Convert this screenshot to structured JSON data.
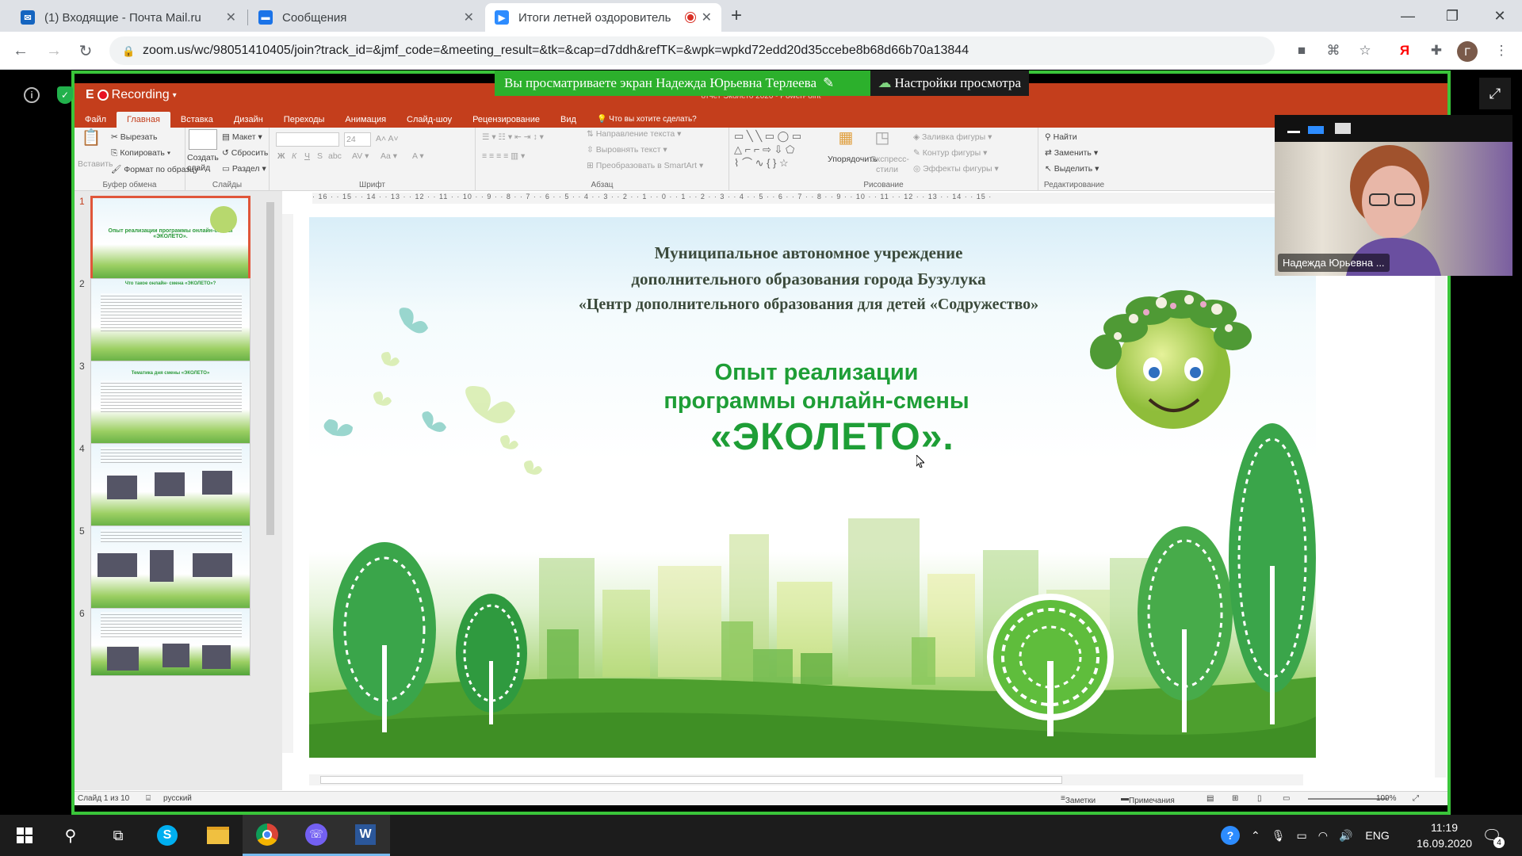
{
  "browser": {
    "tabs": [
      {
        "title": "(1) Входящие - Почта Mail.ru",
        "icon": "mail-icon",
        "color": "#1565c0"
      },
      {
        "title": "Сообщения",
        "icon": "chat-icon",
        "color": "#1a73e8"
      },
      {
        "title": "Итоги летней оздоровитель",
        "icon": "zoom-icon",
        "color": "#2d8cff"
      }
    ],
    "url": "zoom.us/wc/98051410405/join?track_id=&jmf_code=&meeting_result=&tk=&cap=d7ddh&refTK=&wpk=wpkd72edd20d35ccebe8b68d66b70a13844",
    "profile_letter": "Г"
  },
  "zoom": {
    "share_banner": "Вы просматриваете экран Надежда Юрьевна Терлеева",
    "view_options": "Настройки просмотра",
    "participant_name": "Надежда Юрьевна ...",
    "accent": "#2cb02c"
  },
  "ppt": {
    "recording_label": "Recording",
    "app_letter": "E",
    "window_title": "отчет Эколето 2020 - PowerPoint",
    "menu": [
      "Файл",
      "Главная",
      "Вставка",
      "Дизайн",
      "Переходы",
      "Анимация",
      "Слайд-шоу",
      "Рецензирование",
      "Вид"
    ],
    "tell_me": "Что вы хотите сделать?",
    "ribbon": {
      "paste": "Вставить",
      "cut": "Вырезать",
      "copy": "Копировать",
      "format_painter": "Формат по образцу",
      "clipboard": "Буфер обмена",
      "new_slide": "Создать слайд",
      "layout": "Макет",
      "reset": "Сбросить",
      "section": "Раздел",
      "slides": "Слайды",
      "font_size": "24",
      "font": "Шрифт",
      "text_direction": "Направление текста",
      "align_text": "Выровнять текст",
      "smartart": "Преобразовать в SmartArt",
      "paragraph": "Абзац",
      "arrange": "Упорядочить",
      "quick_styles": "Экспресс-стили",
      "shape_fill": "Заливка фигуры",
      "shape_outline": "Контур фигуры",
      "shape_effects": "Эффекты фигуры",
      "drawing": "Рисование",
      "find": "Найти",
      "replace": "Заменить",
      "select": "Выделить",
      "editing": "Редактирование"
    },
    "ruler": "· 16 · · 15 · · 14 · · 13 · · 12 · · 11 · · 10 · · 9 · · 8 · · 7 · · 6 · · 5 · · 4 · · 3 · · 2 · · 1 · · 0 · · 1 · · 2 · · 3 · · 4 · · 5 · · 6 · · 7 · · 8 · · 9 · · 10 · · 11 · · 12 · · 13 · · 14 · · 15 ·",
    "thumbnails": [
      {
        "num": "1",
        "title": "Опыт реализации программы онлайн-смены «ЭКОЛЕТО»."
      },
      {
        "num": "2",
        "title": "Что такое онлайн- смена «ЭКОЛЕТО»?"
      },
      {
        "num": "3",
        "title": "Тематика дня смены «ЭКОЛЕТО»"
      },
      {
        "num": "4",
        "title": ""
      },
      {
        "num": "5",
        "title": ""
      },
      {
        "num": "6",
        "title": ""
      }
    ],
    "slide": {
      "header_line1": "Муниципальное автономное учреждение",
      "header_line2": "дополнительного образования города Бузулука",
      "header_line3": "«Центр дополнительного образования для детей «Содружество»",
      "title_line1": "Опыт реализации",
      "title_line2": "программы онлайн-смены",
      "title_line3": "«ЭКОЛЕТО»."
    },
    "status": {
      "slide_of": "Слайд 1 из 10",
      "language": "русский",
      "notes": "Заметки",
      "comments": "Примечания",
      "zoom": "109%"
    }
  },
  "taskbar": {
    "language": "ENG",
    "time": "11:19",
    "date": "16.09.2020",
    "notifications": "4"
  }
}
